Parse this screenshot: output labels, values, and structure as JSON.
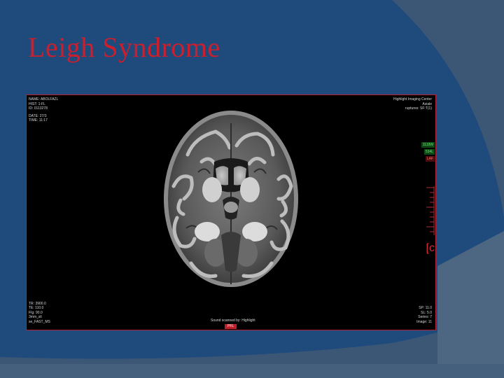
{
  "slide": {
    "title": "Leigh Syndrome",
    "colors": {
      "background": "#1f4a7c",
      "title": "#cc1f2e",
      "panel_border": "#b8202e"
    }
  },
  "mri": {
    "top_left": [
      "NAME: ABOLFAZL",
      "HIST: 1-FL",
      "ID: 0113278",
      "",
      "DATE: 27/3",
      "TIME: 11:17"
    ],
    "top_right": [
      "Highlight Imaging Center",
      "Axiale",
      "ruptures: SF:T(1)"
    ],
    "bottom_left": [
      "TR: 3900.0",
      "TE: 110.0",
      "FIg: 90.0",
      "3mm_sli",
      "se_FAST_MS"
    ],
    "bottom_right": [
      "SP: 11.0",
      "SL: 5.0",
      "Series: 7",
      "Image: 11"
    ],
    "bottom_center": "Sound scanned by: Highlight",
    "tags": [
      "1119W",
      "534L",
      "LAF"
    ],
    "bracket": "[c",
    "orientation_button": "PFL"
  }
}
